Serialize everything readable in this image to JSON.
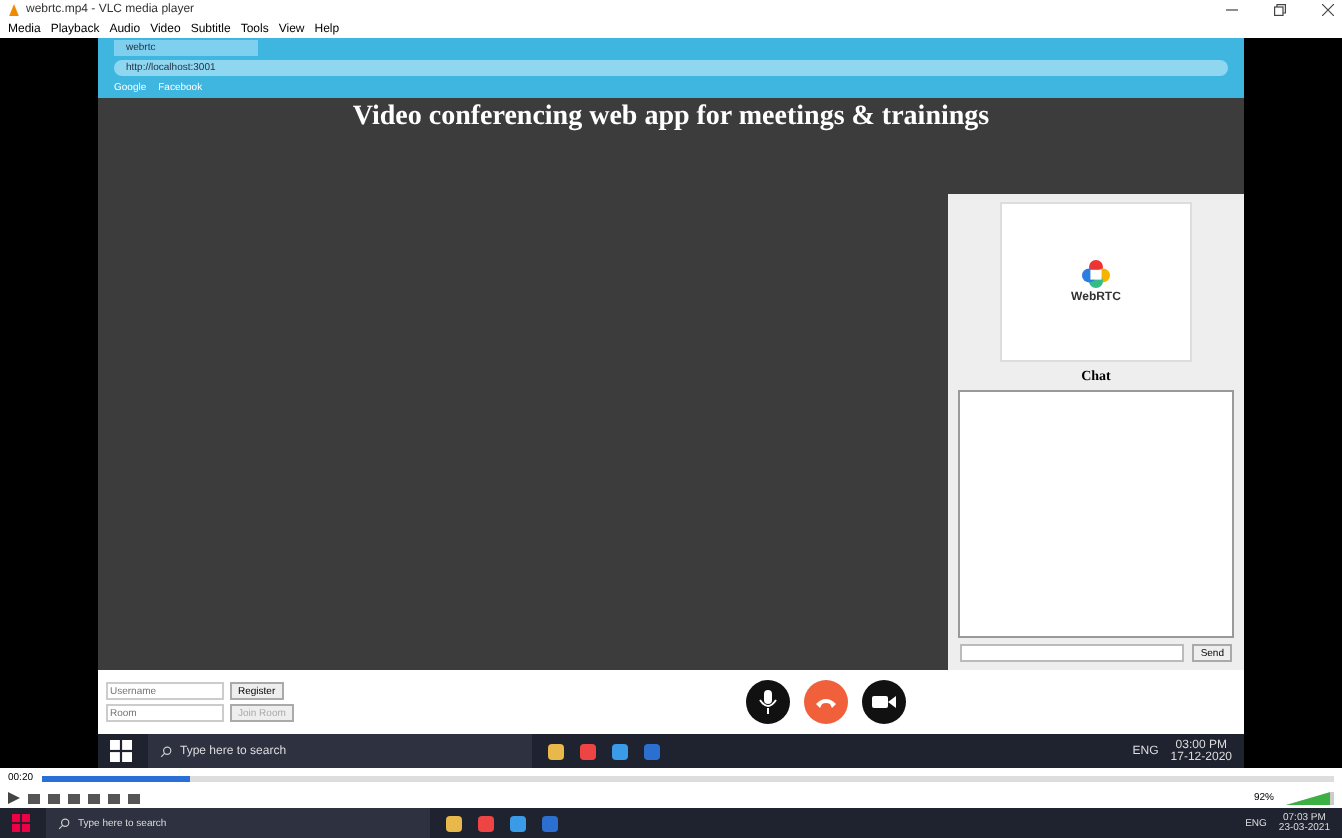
{
  "window": {
    "title": "webrtc.mp4 - VLC media player"
  },
  "menu": [
    "Media",
    "Playback",
    "Audio",
    "Video",
    "Subtitle",
    "Tools",
    "View",
    "Help"
  ],
  "browser": {
    "tab": "webrtc",
    "url": "http://localhost:3001",
    "bookmarks": [
      "Google",
      "Facebook"
    ]
  },
  "app": {
    "heading": "Video conferencing web app for meetings & trainings",
    "logo_text": "WebRTC",
    "chat_title": "Chat",
    "send": "Send",
    "username": {
      "placeholder": "Username"
    },
    "register": "Register",
    "room": {
      "placeholder": "Room"
    },
    "join": {
      "label": "Join Room",
      "disabled": true
    }
  },
  "video_taskbar": {
    "search": "Type here to search",
    "lang": "ENG",
    "time": "03:00 PM",
    "date": "17-12-2020"
  },
  "player": {
    "elapsed": "00:20",
    "seek": {
      "level": 0.115
    },
    "volume": {
      "level": 0.92,
      "reading": "92%"
    }
  },
  "taskbar": {
    "search": "Type here to search",
    "lang": "ENG",
    "time": "07:03 PM",
    "date": "23-03-2021"
  }
}
